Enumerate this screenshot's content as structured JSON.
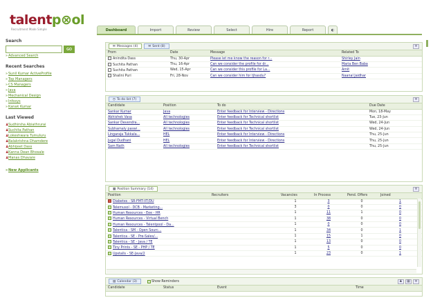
{
  "logo": {
    "word_a": "talent",
    "word_b": "p",
    "word_c": "ol",
    "tagline": "Recruitment Made Simple"
  },
  "nav": {
    "tabs": [
      {
        "label": "Dashboard",
        "active": true
      },
      {
        "label": "Import",
        "active": false
      },
      {
        "label": "Review",
        "active": false
      },
      {
        "label": "Select",
        "active": false
      },
      {
        "label": "Hire",
        "active": false
      },
      {
        "label": "Report",
        "active": false
      }
    ]
  },
  "sidebar": {
    "search_heading": "Search",
    "search_value": "",
    "go_label": "GO",
    "advanced_search": "Advanced Search",
    "recent_heading": "Recent Searches",
    "recent": [
      "Sunil Kumar ActiveProfile",
      "Top Managers",
      "CS Managers",
      "Java",
      "Mechanical Design",
      "Infosys",
      "Kanak Kumar"
    ],
    "viewed_heading": "Last Viewed",
    "viewed": [
      "Sudhirsha Abiathrurai",
      "Suchita Pathan",
      "Lokeshwara Tumuluru",
      "Balakrishna Dhamdere",
      "Abhijeet Dass",
      "Kanna Dean Bhosale",
      "Manas Dhavare"
    ],
    "new_applicants": "New Applicants"
  },
  "messages": {
    "tab_messages": "Messages (4)",
    "tab_sent": "Sent (8)",
    "columns": [
      "From",
      "Date",
      "Message",
      "Related To"
    ],
    "rows": [
      [
        "Anindita Dass",
        "Thu, 30-Apr",
        "Please let me know the reason for r...",
        "Shirley Jain"
      ],
      [
        "Suchita Pathan",
        "Thu, 16-Apr",
        "Can we consider the profile for dr...",
        "Maria Ben Baba"
      ],
      [
        "Suchita Pathan",
        "Wed, 15-Apr",
        "Can we consider this profile for La...",
        "Amit"
      ],
      [
        "Shalini Puri",
        "Fri, 28-Nov",
        "Can we consider him for tjhasdu?",
        "Naanal Jaidhar"
      ]
    ]
  },
  "todo": {
    "tab_label": "To do list (7)",
    "columns": [
      "Candidate",
      "Position",
      "To do",
      "Due Date"
    ],
    "rows": [
      [
        "Sankar Kumar",
        "Java",
        "Enter feedback for Interview - Directions",
        "Mon, 18-May"
      ],
      [
        "Abhishek Vasa",
        "All technologies",
        "Enter feedback for Technical shortlist",
        "Tue, 23-Jun"
      ],
      [
        "Sankar Devendra...",
        "All technologies",
        "Enter feedback for Technical shortlist",
        "Wed, 24-Jun"
      ],
      [
        "Subhamaly paswi...",
        "All technologies",
        "Enter feedback for Technical shortlist",
        "Wed, 24-Jun"
      ],
      [
        "Lingaraja Tukkala...",
        "HEL",
        "Enter feedback for Interview - Directions",
        "Thu, 25-Jun"
      ],
      [
        "Jugal Dudhani",
        "HEL",
        "Enter feedback for Interview - Directions",
        "Thu, 25-Jun"
      ],
      [
        "Sam Nath",
        "All technologies",
        "Enter feedback for Technical shortlist",
        "Thu, 25-Jun"
      ]
    ]
  },
  "summary": {
    "tab_label": "Position Summary (14)",
    "columns": [
      "Position",
      "Recruiters",
      "Vacancies",
      "In Process",
      "Pend. Offers",
      "Joined"
    ],
    "rows": [
      {
        "position": "Diabetes - SR-FMT-IIT/DU",
        "recruiters": "",
        "vacancies": "1",
        "in_process": "3",
        "pend_offers": "0",
        "joined": "1",
        "flag": "red"
      },
      {
        "position": "Telemusol - DCB - Marketing...",
        "recruiters": "",
        "vacancies": "3",
        "in_process": "0",
        "pend_offers": "0",
        "joined": "0",
        "flag": "green"
      },
      {
        "position": "Human Resources - Eee - HR",
        "recruiters": "",
        "vacancies": "1",
        "in_process": "11",
        "pend_offers": "1",
        "joined": "0",
        "flag": "green"
      },
      {
        "position": "Human Resources - Virtual Bench",
        "recruiters": "",
        "vacancies": "1",
        "in_process": "38",
        "pend_offers": "0",
        "joined": "0",
        "flag": "green"
      },
      {
        "position": "Human Resources - Talentpool - Da...",
        "recruiters": "",
        "vacancies": "1",
        "in_process": "0",
        "pend_offers": "0",
        "joined": "0",
        "flag": "green"
      },
      {
        "position": "Talentica - SM - Open Sourc...",
        "recruiters": "",
        "vacancies": "1",
        "in_process": "34",
        "pend_offers": "0",
        "joined": "1",
        "flag": "green"
      },
      {
        "position": "Talentica - SE - Pre-Sales/...",
        "recruiters": "",
        "vacancies": "1",
        "in_process": "15",
        "pend_offers": "1",
        "joined": "0",
        "flag": "green"
      },
      {
        "position": "Talentica - SE - Java / TE",
        "recruiters": "",
        "vacancies": "1",
        "in_process": "13",
        "pend_offers": "0",
        "joined": "0",
        "flag": "green"
      },
      {
        "position": "Tiny Prints - SE - PHP / TE",
        "recruiters": "",
        "vacancies": "1",
        "in_process": "5",
        "pend_offers": "0",
        "joined": "0",
        "flag": "green"
      },
      {
        "position": "Upstalls - SE-Java/2",
        "recruiters": "",
        "vacancies": "1",
        "in_process": "23",
        "pend_offers": "0",
        "joined": "1",
        "flag": "green"
      }
    ]
  },
  "calendar": {
    "tab_label": "Calendar (3)",
    "show_reminders": "Show Reminders",
    "columns": [
      "Candidate",
      "Status",
      "Event",
      "Time"
    ]
  },
  "colors": {
    "brand_red": "#9a1c2c",
    "brand_green": "#6a9d2a",
    "link_blue": "#2b2b88"
  }
}
